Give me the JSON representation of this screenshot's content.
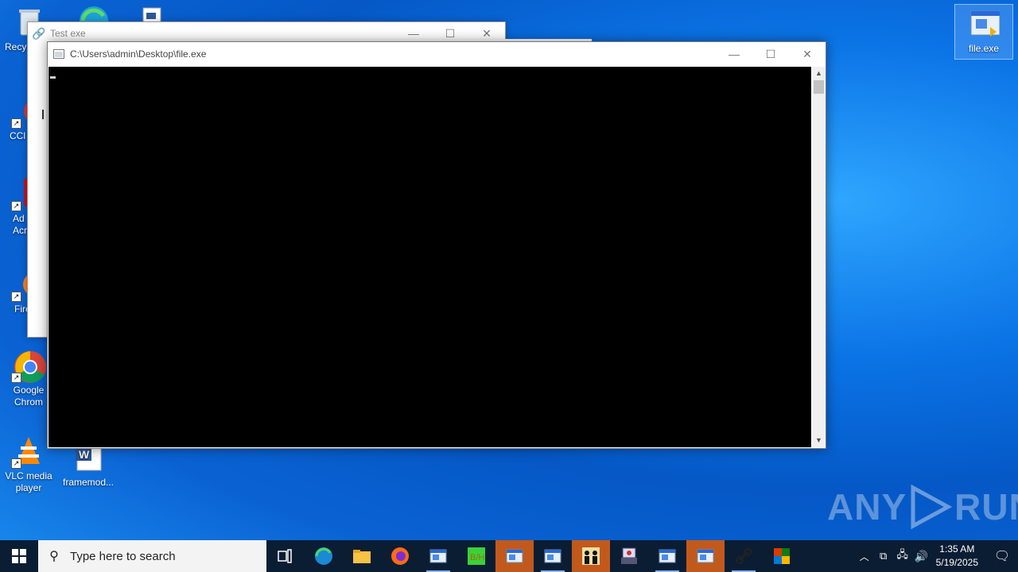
{
  "desktop": {
    "icons": [
      {
        "label": "Recy",
        "name": "recycle-bin"
      },
      {
        "label": "CCl",
        "name": "ccleaner"
      },
      {
        "label": "Ad\nAcr",
        "name": "adobe-acrobat"
      },
      {
        "label": "Fire",
        "name": "firefox"
      },
      {
        "label": "Google\nChrom",
        "name": "google-chrome"
      },
      {
        "label": "VLC media\nplayer",
        "name": "vlc"
      },
      {
        "label": "framemod...",
        "name": "word-doc"
      },
      {
        "label": "file.exe",
        "name": "file-exe"
      }
    ]
  },
  "back_window": {
    "title": "Test exe"
  },
  "console_window": {
    "title": "C:\\Users\\admin\\Desktop\\file.exe"
  },
  "watermark": {
    "text_left": "ANY",
    "text_right": "RUN"
  },
  "taskbar": {
    "search_placeholder": "Type here to search",
    "time": "1:35 AM",
    "date": "5/19/2025"
  },
  "colors": {
    "desktop": "#0b74e6",
    "taskbar": "#0b1d33",
    "console_bg": "#000000",
    "active_task": "#c2591c"
  }
}
